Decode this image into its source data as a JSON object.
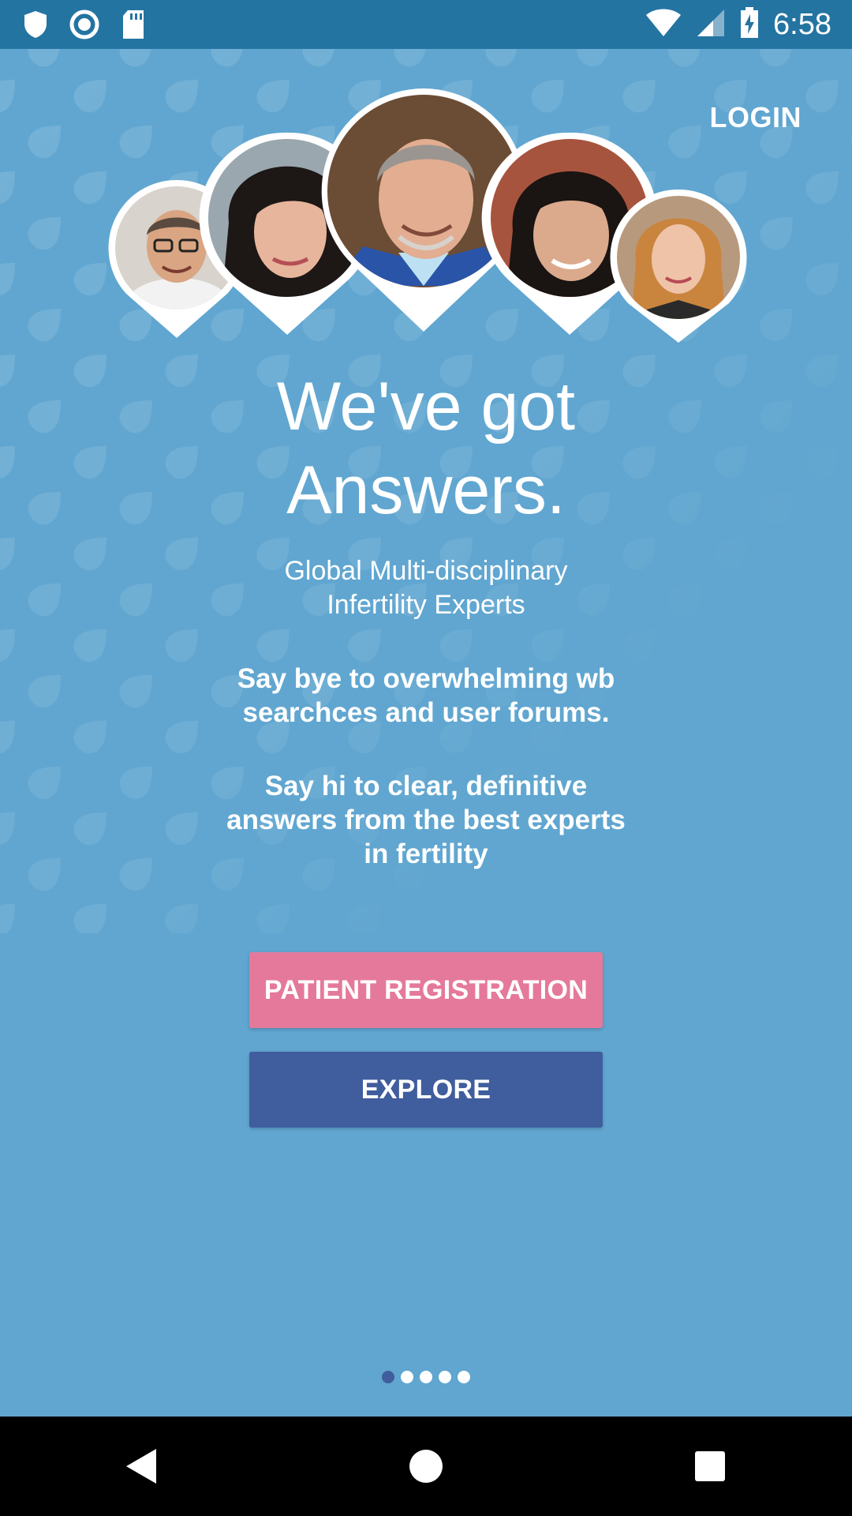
{
  "status_bar": {
    "time": "6:58",
    "left_icons": [
      "shield-icon",
      "sync-icon",
      "sd-card-icon"
    ],
    "right_icons": [
      "wifi-icon",
      "cellular-signal-icon",
      "battery-charging-icon"
    ]
  },
  "header": {
    "login_label": "LOGIN"
  },
  "experts": [
    "expert-avatar-1",
    "expert-avatar-2",
    "expert-avatar-3",
    "expert-avatar-4",
    "expert-avatar-5"
  ],
  "hero": {
    "title_line1": "We've got",
    "title_line2": "Answers."
  },
  "subtitle": {
    "line1": "Global Multi-disciplinary",
    "line2": "Infertility Experts"
  },
  "message_bye": {
    "line1": "Say bye to overwhelming wb",
    "line2": "searchces and user forums."
  },
  "message_hi": {
    "line1": "Say hi to clear, definitive",
    "line2": "answers from the best experts",
    "line3": "in fertility"
  },
  "buttons": {
    "register_label": "PATIENT REGISTRATION",
    "explore_label": "EXPLORE"
  },
  "pager": {
    "count": 5,
    "active_index": 0
  },
  "nav_bar": [
    "back-icon",
    "home-icon",
    "recents-icon"
  ],
  "colors": {
    "status_bar": "#2474a2",
    "background": "#60a6d0",
    "register_button": "#e5799b",
    "explore_button": "#405d9d",
    "active_dot": "#405d9d"
  }
}
